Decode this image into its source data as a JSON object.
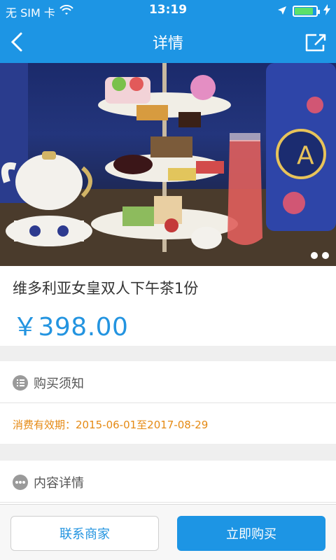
{
  "status_bar": {
    "carrier": "无 SIM 卡",
    "time": "13:19",
    "battery_level": 0.85
  },
  "nav": {
    "title": "详情"
  },
  "hero": {
    "slides_count": 2,
    "active_slide": 1
  },
  "product": {
    "title": "维多利亚女皇双人下午茶1份",
    "price": "￥398.00"
  },
  "purchase_notice": {
    "title": "购买须知",
    "validity": "消费有效期：2015-06-01至2017-08-29"
  },
  "content_details": {
    "title": "内容详情"
  },
  "actions": {
    "contact_label": "联系商家",
    "buy_label": "立即购买"
  },
  "colors": {
    "primary": "#1d95e4",
    "price": "#2394e0",
    "notice": "#e58a14"
  },
  "icons": {
    "back": "chevron-left-icon",
    "share": "share-icon",
    "wifi": "wifi-icon",
    "location": "location-arrow-icon",
    "battery": "battery-icon",
    "charging": "charging-bolt-icon",
    "notice": "list-icon",
    "details": "more-dots-icon"
  }
}
